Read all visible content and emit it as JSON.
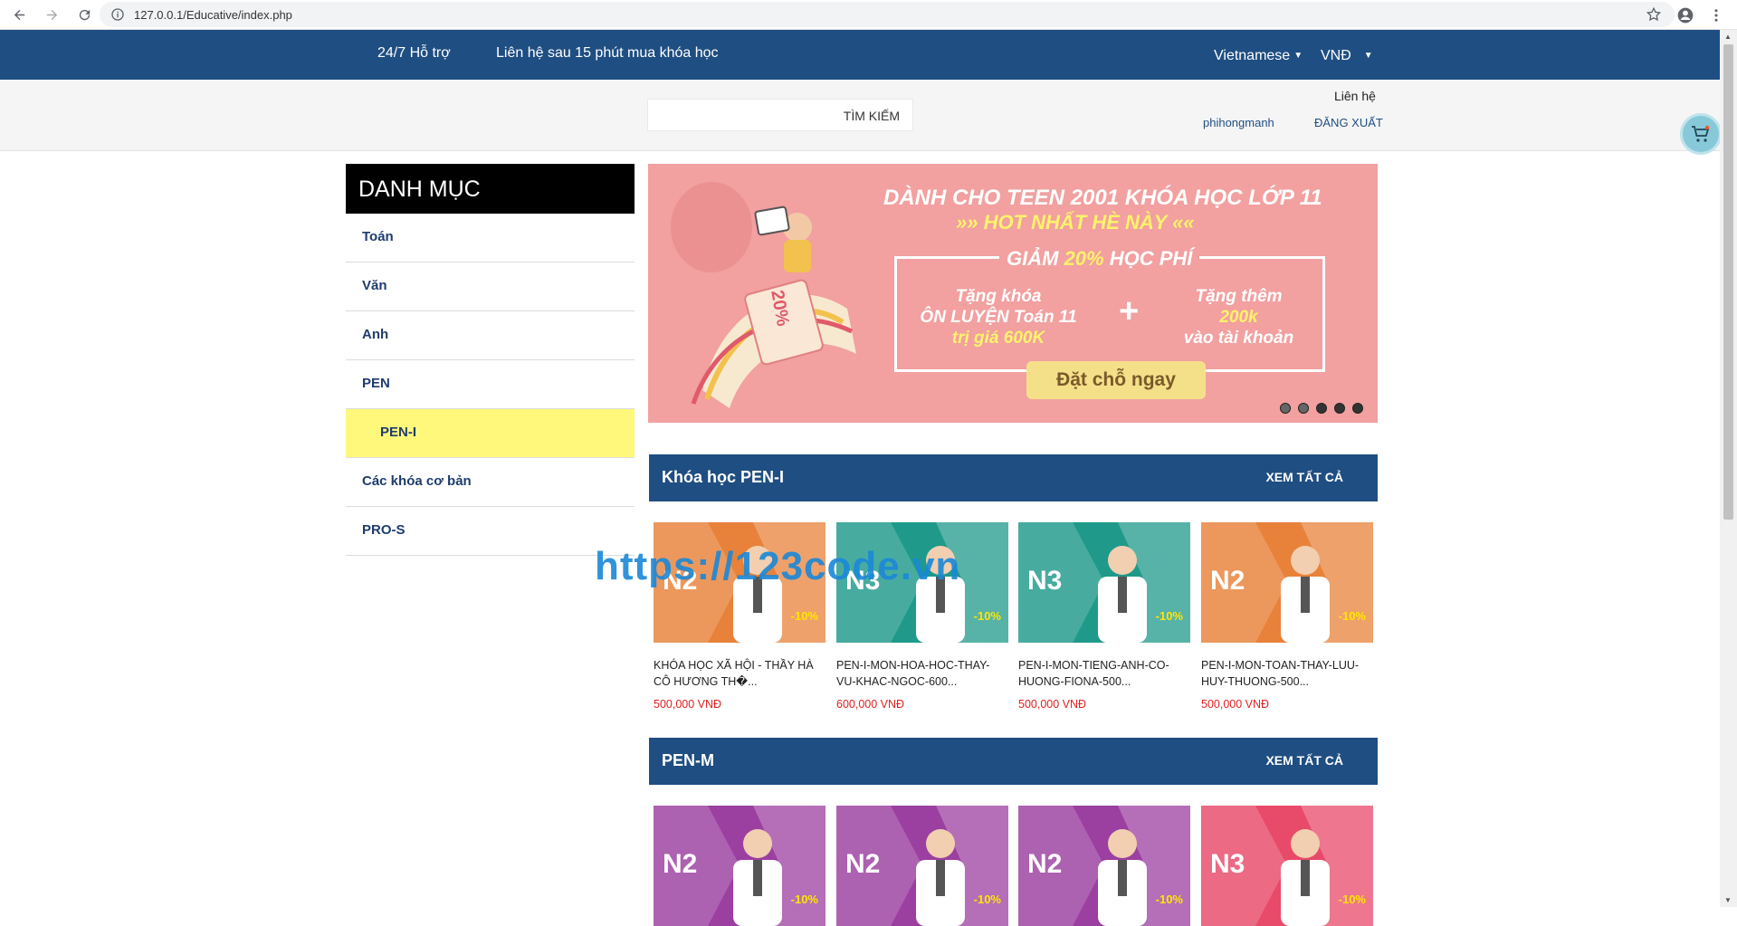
{
  "browser": {
    "url": "127.0.0.1/Educative/index.php"
  },
  "topbar": {
    "support": "24/7 Hỗ trợ",
    "contact_note": "Liên hệ sau 15 phút mua khóa học",
    "language": "Vietnamese",
    "currency": "VNĐ"
  },
  "header": {
    "search_placeholder": "",
    "search_button": "TÌM KIẾM",
    "contact": "Liên hệ",
    "username": "phihongmanh",
    "logout": "ĐĂNG XUẤT"
  },
  "sidebar": {
    "title": "DANH MỤC",
    "items": [
      {
        "label": "Toán"
      },
      {
        "label": "Văn"
      },
      {
        "label": "Anh"
      },
      {
        "label": "PEN"
      },
      {
        "label": "PEN-I"
      },
      {
        "label": "Các khóa cơ bản"
      },
      {
        "label": "PRO-S"
      }
    ]
  },
  "banner": {
    "line1": "DÀNH CHO TEEN 2001 KHÓA HỌC LỚP 11",
    "line2": "»» HOT NHẤT HÈ NÀY ««",
    "discount_pre": "GIẢM ",
    "discount_val": "20%",
    "discount_post": " HỌC PHÍ",
    "gift1_a": "Tặng khóa",
    "gift1_b": "ÔN LUYỆN Toán 11",
    "gift1_c": "trị giá 600K",
    "gift2_a": "Tặng thêm",
    "gift2_b": "200k",
    "gift2_c": "vào tài khoản",
    "cta": "Đặt chỗ ngay",
    "badge": "20%",
    "slides": 5,
    "active_slide": 2
  },
  "sections": [
    {
      "title": "Khóa học PEN-I",
      "view_all": "XEM TẤT CẢ",
      "courses": [
        {
          "level": "N2",
          "discount": "-10%",
          "name": "KHÓA HỌC XÃ HỘI - THẦY HÀ CÔ HƯƠNG TH�...",
          "price": "500,000 VNĐ",
          "bg": "#e8823a"
        },
        {
          "level": "N3",
          "discount": "-10%",
          "name": "PEN-I-MON-HOA-HOC-THAY-VU-KHAC-NGOC-600...",
          "price": "600,000 VNĐ",
          "bg": "#1f9a8a"
        },
        {
          "level": "N3",
          "discount": "-10%",
          "name": "PEN-I-MON-TIENG-ANH-CO-HUONG-FIONA-500...",
          "price": "500,000 VNĐ",
          "bg": "#1f9a8a"
        },
        {
          "level": "N2",
          "discount": "-10%",
          "name": "PEN-I-MON-TOAN-THAY-LUU-HUY-THUONG-500...",
          "price": "500,000 VNĐ",
          "bg": "#e8823a"
        }
      ]
    },
    {
      "title": "PEN-M",
      "view_all": "XEM TẤT CẢ",
      "courses": [
        {
          "level": "N2",
          "discount": "-10%",
          "bg": "#9b3fa0"
        },
        {
          "level": "N2",
          "discount": "-10%",
          "bg": "#9b3fa0"
        },
        {
          "level": "N2",
          "discount": "-10%",
          "bg": "#9b3fa0"
        },
        {
          "level": "N3",
          "discount": "-10%",
          "bg": "#e84a6a"
        }
      ]
    }
  ],
  "watermark": "https://123code.vn"
}
